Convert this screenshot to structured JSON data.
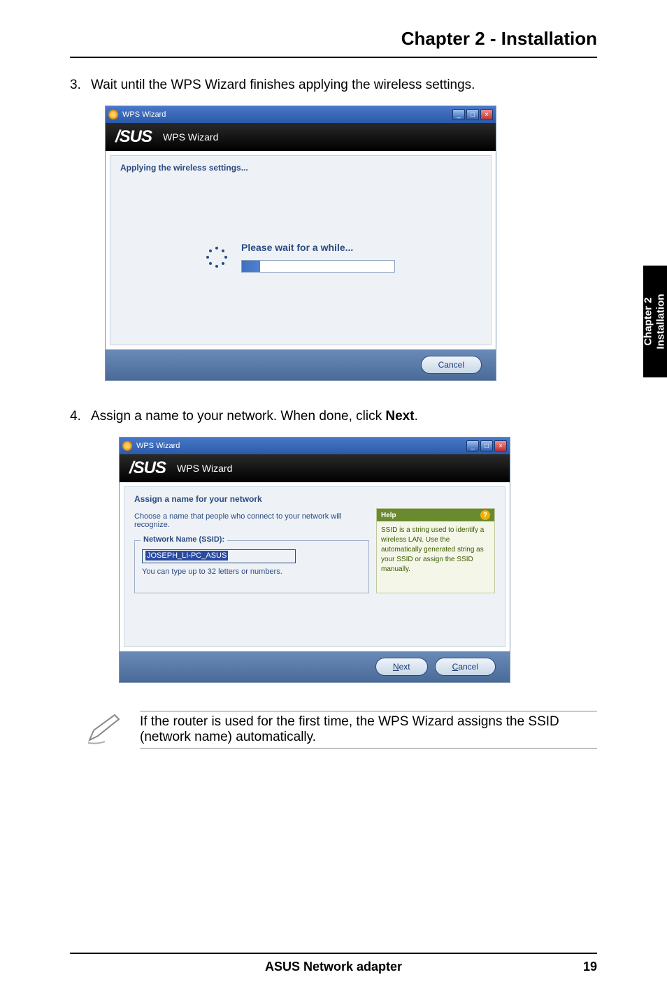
{
  "chapterTitle": "Chapter 2 - Installation",
  "step3": {
    "num": "3.",
    "text": "Wait until the WPS Wizard finishes applying the wireless settings."
  },
  "step4": {
    "num": "4.",
    "textBefore": "Assign a name to your network. When done, click ",
    "bold": "Next",
    "textAfter": "."
  },
  "sideTab": {
    "line1": "Chapter 2",
    "line2": "Installation"
  },
  "dialog1": {
    "windowTitle": "WPS Wizard",
    "brand": "WPS Wizard",
    "sectionTitle": "Applying the wireless settings...",
    "progressLabel": "Please wait for a while...",
    "progressPercent": 12,
    "cancel": "Cancel"
  },
  "dialog2": {
    "windowTitle": "WPS Wizard",
    "brand": "WPS Wizard",
    "sectionTitle": "Assign a name for your network",
    "instruction": "Choose a name that people who connect to your network will recognize.",
    "fieldLegend": "Network Name (SSID):",
    "ssidValue": "JOSEPH_LI-PC_ASUS",
    "hint": "You can type up to 32 letters or numbers.",
    "helpTitle": "Help",
    "helpBody": "SSID is a string used to identify a wireless LAN. Use the automatically generated string as your SSID or assign the SSID manually.",
    "next": "Next",
    "cancel": "Cancel"
  },
  "note": "If the router is used for the first time, the WPS Wizard assigns the SSID (network name) automatically.",
  "footer": {
    "product": "ASUS Network adapter",
    "page": "19"
  }
}
